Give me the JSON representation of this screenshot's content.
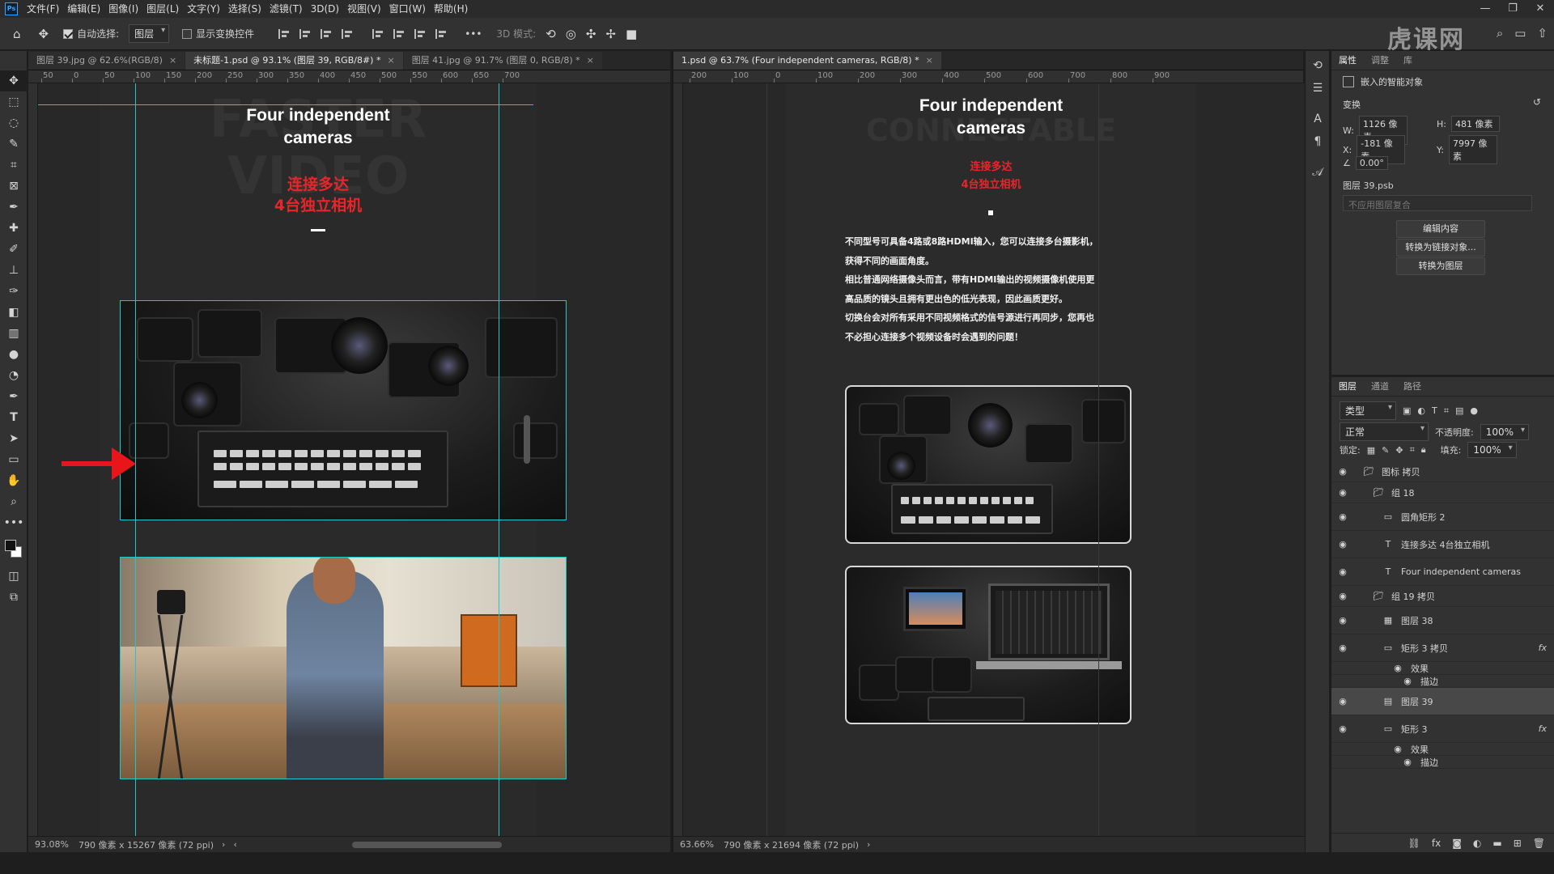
{
  "menu": [
    "文件(F)",
    "编辑(E)",
    "图像(I)",
    "图层(L)",
    "文字(Y)",
    "选择(S)",
    "滤镜(T)",
    "3D(D)",
    "视图(V)",
    "窗口(W)",
    "帮助(H)"
  ],
  "ps_logo": "Ps",
  "options": {
    "auto_select_label": "自动选择:",
    "auto_select_target": "图层",
    "show_transform_label": "显示变换控件",
    "three_d_mode_label": "3D 模式:",
    "more": "•••"
  },
  "watermark": "虎课网",
  "left_doc": {
    "tabs": [
      {
        "label": "图层 39.jpg @ 62.6%(RGB/8)",
        "active": false
      },
      {
        "label": "未标题-1.psd @ 93.1% (图层 39, RGB/8#) *",
        "active": true
      },
      {
        "label": "图层 41.jpg @ 91.7% (图层 0, RGB/8) *",
        "active": false
      }
    ],
    "ruler_labels": [
      "50",
      "0",
      "50",
      "100",
      "150",
      "200",
      "250",
      "300",
      "350",
      "400",
      "450",
      "500",
      "550",
      "600",
      "650",
      "700"
    ],
    "title_en_line1": "Four independent",
    "title_en_line2": "cameras",
    "title_cn_line1": "连接多达",
    "title_cn_line2": "4台独立相机",
    "bg_text": "FASTER VIDEO",
    "status_zoom": "93.08%",
    "status_info": "790 像素 x 15267 像素 (72 ppi)"
  },
  "right_doc": {
    "tab": "1.psd @ 63.7% (Four independent cameras, RGB/8) *",
    "ruler_labels": [
      "200",
      "100",
      "0",
      "100",
      "200",
      "300",
      "400",
      "500",
      "600",
      "700",
      "800",
      "900"
    ],
    "title_en_line1": "Four independent",
    "title_en_line2": "cameras",
    "title_cn_line1": "连接多达",
    "title_cn_line2": "4台独立相机",
    "bg_text": "CONNECTABLE",
    "body": [
      "不同型号可具备4路或8路HDMI输入，您可以连接多台摄影机，",
      "获得不同的画面角度。",
      "相比普通网络摄像头而言，带有HDMI输出的视频摄像机使用更",
      "高品质的镜头且拥有更出色的低光表现，因此画质更好。",
      "切换台会对所有采用不同视频格式的信号源进行再同步，您再也",
      "不必担心连接多个视频设备时会遇到的问题！"
    ],
    "status_zoom": "63.66%",
    "status_info": "790 像素 x 21694 像素 (72 ppi)"
  },
  "properties": {
    "tabs": [
      "属性",
      "调整",
      "库"
    ],
    "smart_object_label": "嵌入的智能对象",
    "transform_label": "变换",
    "w_label": "W:",
    "w_value": "1126 像素",
    "h_label": "H:",
    "h_value": "481 像素",
    "x_label": "X:",
    "x_value": "-181 像素",
    "y_label": "Y:",
    "y_value": "7997 像素",
    "angle_value": "0.00°",
    "file_name": "图层 39.psb",
    "comp_placeholder": "不应用图层复合",
    "btn_edit": "编辑内容",
    "btn_link": "转换为链接对象...",
    "btn_layer": "转换为图层"
  },
  "layers_panel": {
    "tabs": [
      "图层",
      "通道",
      "路径"
    ],
    "filter_label": "类型",
    "blend_mode": "正常",
    "opacity_label": "不透明度:",
    "opacity_value": "100%",
    "lock_label": "锁定:",
    "fill_label": "填充:",
    "fill_value": "100%",
    "rows": [
      {
        "name": "图标 拷贝",
        "kind": "folder"
      },
      {
        "name": "组 18",
        "kind": "folder"
      },
      {
        "name": "圆角矩形 2",
        "kind": "shape"
      },
      {
        "name": "连接多达 4台独立相机",
        "kind": "text"
      },
      {
        "name": "Four independent cameras",
        "kind": "text"
      },
      {
        "name": "组 19 拷贝",
        "kind": "folder"
      },
      {
        "name": "图层 38",
        "kind": "pixel"
      },
      {
        "name": "矩形 3 拷贝",
        "kind": "shape"
      },
      {
        "name": "效果",
        "kind": "effect"
      },
      {
        "name": "描边",
        "kind": "effect"
      },
      {
        "name": "图层 39",
        "kind": "smart"
      },
      {
        "name": "矩形 3",
        "kind": "shape"
      },
      {
        "name": "效果",
        "kind": "effect"
      },
      {
        "name": "描边",
        "kind": "effect"
      }
    ],
    "fx_label": "fx"
  }
}
